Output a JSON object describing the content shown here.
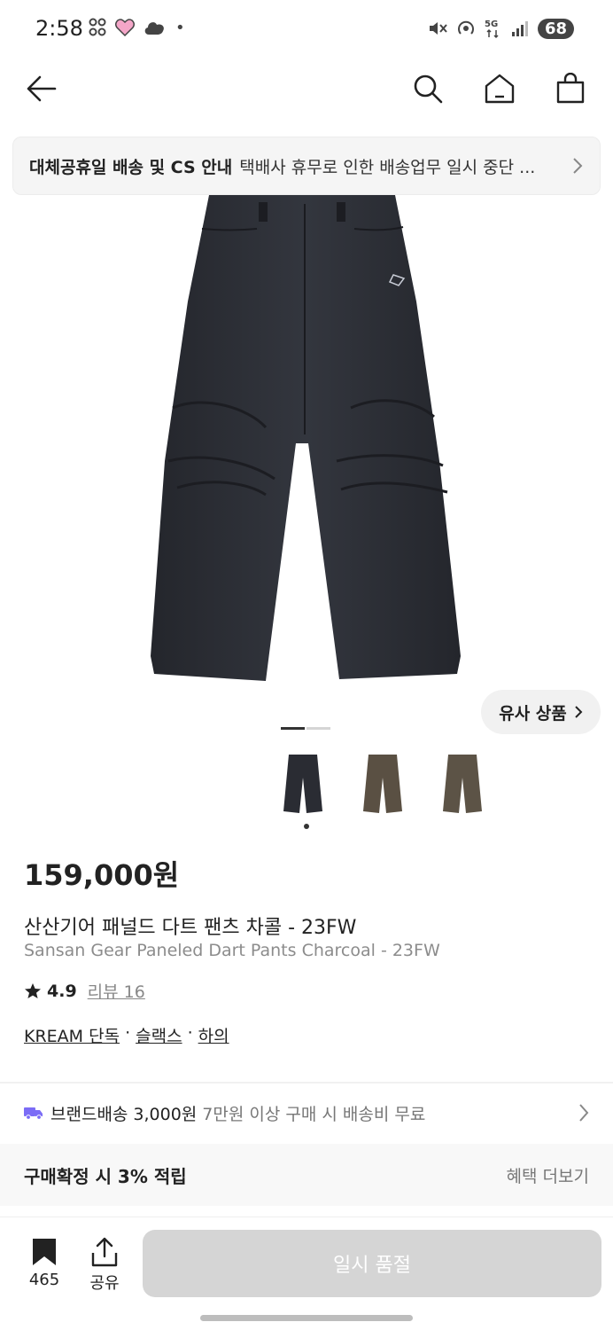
{
  "status_bar": {
    "time": "2:58",
    "battery": "68"
  },
  "nav": {
    "back_icon": "arrow-left-icon",
    "search_icon": "search-icon",
    "home_icon": "home-icon",
    "bag_icon": "shopping-bag-icon"
  },
  "notice": {
    "title": "대체공휴일 배송 및 CS 안내",
    "text": "택배사 휴무로 인한 배송업무 일시 중단 ..."
  },
  "gallery": {
    "similar_label": "유사 상품",
    "page_index": 1,
    "page_count": 2,
    "thumbnails": [
      {
        "color": "#2a2c33"
      },
      {
        "color": "#5a5043"
      },
      {
        "color": "#5c5346"
      }
    ]
  },
  "product": {
    "price": "159,000원",
    "name_ko": "산산기어 패널드 다트 팬츠 차콜 - 23FW",
    "name_en": "Sansan Gear Paneled Dart Pants Charcoal - 23FW",
    "rating": "4.9",
    "review_label": "리뷰 16",
    "tags": [
      "KREAM 단독",
      "슬랙스",
      "하의"
    ],
    "tag_separator": "·"
  },
  "shipping": {
    "label": "브랜드배송",
    "price": "3,000원",
    "condition": "7만원 이상 구매 시 배송비 무료"
  },
  "benefit": {
    "title": "구매확정 시 3% 적립",
    "more": "혜택 더보기"
  },
  "bottom": {
    "wish_count": "465",
    "share_label": "공유",
    "soldout_label": "일시 품절"
  },
  "colors": {
    "pants": "#2b2d34",
    "accent_truck": "#7b6cf6",
    "disabled_button": "#d5d5d5"
  }
}
